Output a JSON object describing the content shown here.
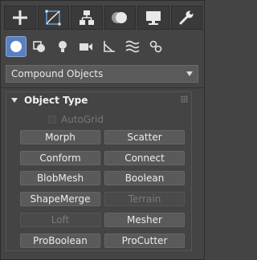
{
  "tabs": [
    {
      "id": "create",
      "icon": "plus-icon"
    },
    {
      "id": "modify",
      "icon": "modify-curve-icon"
    },
    {
      "id": "hierarchy",
      "icon": "hierarchy-icon"
    },
    {
      "id": "motion",
      "icon": "motion-icon"
    },
    {
      "id": "display",
      "icon": "display-monitor-icon"
    },
    {
      "id": "utilities",
      "icon": "wrench-icon"
    }
  ],
  "sub_icons": [
    "geometry-sphere-icon",
    "shapes-icon",
    "lights-icon",
    "cameras-icon",
    "helpers-icon",
    "space-warps-icon",
    "systems-icon"
  ],
  "dropdown": {
    "value": "Compound Objects"
  },
  "rollout": {
    "title": "Object Type",
    "autogrid": "AutoGrid",
    "buttons": [
      {
        "label": "Morph",
        "enabled": true
      },
      {
        "label": "Scatter",
        "enabled": true
      },
      {
        "label": "Conform",
        "enabled": true
      },
      {
        "label": "Connect",
        "enabled": true
      },
      {
        "label": "BlobMesh",
        "enabled": true
      },
      {
        "label": "Boolean",
        "enabled": true
      },
      {
        "label": "ShapeMerge",
        "enabled": true
      },
      {
        "label": "Terrain",
        "enabled": false
      },
      {
        "label": "Loft",
        "enabled": false
      },
      {
        "label": "Mesher",
        "enabled": true
      },
      {
        "label": "ProBoolean",
        "enabled": true
      },
      {
        "label": "ProCutter",
        "enabled": true
      }
    ]
  },
  "colors": {
    "accent": "#5b7fbf",
    "panel": "#444444",
    "button": "#5a5a5a"
  }
}
